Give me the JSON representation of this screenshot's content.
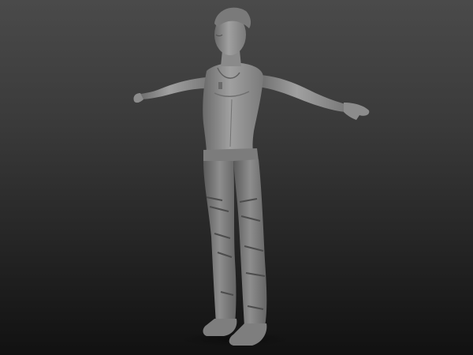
{
  "viewport": {
    "background_top": "#4a4a4a",
    "background_bottom": "#111111",
    "model_material_color": "#8a8a8a",
    "subject": "sculpted-male-figure-t-pose"
  }
}
